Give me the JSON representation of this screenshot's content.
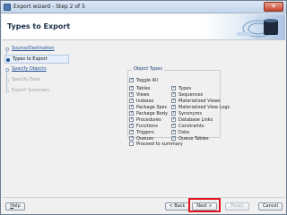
{
  "window": {
    "title": "Export wizard - Step 2 of 5",
    "close_glyph": "✕"
  },
  "header": {
    "title": "Types to Export"
  },
  "steps": [
    {
      "label": "Source/Destination",
      "state": "done"
    },
    {
      "label": "Types to Export",
      "state": "current"
    },
    {
      "label": "Specify Objects",
      "state": "link"
    },
    {
      "label": "Specify Data",
      "state": "disabled"
    },
    {
      "label": "Export Summary",
      "state": "disabled"
    }
  ],
  "object_types": {
    "legend": "Object Types",
    "toggle_all": {
      "label": "Toggle All",
      "checked": true
    },
    "left_column": [
      {
        "label": "Tables",
        "checked": true
      },
      {
        "label": "Views",
        "checked": true
      },
      {
        "label": "Indexes",
        "checked": true
      },
      {
        "label": "Package Spec",
        "checked": true
      },
      {
        "label": "Package Body",
        "checked": true
      },
      {
        "label": "Procedures",
        "checked": true
      },
      {
        "label": "Functions",
        "checked": true
      },
      {
        "label": "Triggers",
        "checked": true
      },
      {
        "label": "Queues",
        "checked": true
      }
    ],
    "right_column": [
      {
        "label": "Types",
        "checked": true
      },
      {
        "label": "Sequences",
        "checked": true
      },
      {
        "label": "Materialized Views",
        "checked": true
      },
      {
        "label": "Materialized View Logs",
        "checked": true
      },
      {
        "label": "Synonyms",
        "checked": true
      },
      {
        "label": "Database Links",
        "checked": true
      },
      {
        "label": "Constraints",
        "checked": true
      },
      {
        "label": "Data",
        "checked": true
      },
      {
        "label": "Queue Tables",
        "checked": true
      }
    ]
  },
  "proceed_to_summary": {
    "label": "Proceed to summary",
    "checked": false
  },
  "footer": {
    "help": "Help",
    "back": "< Back",
    "next": "Next >",
    "finish": "Finish",
    "cancel": "Cancel"
  },
  "colors": {
    "link": "#1f4f97",
    "highlight": "#e3141e"
  }
}
